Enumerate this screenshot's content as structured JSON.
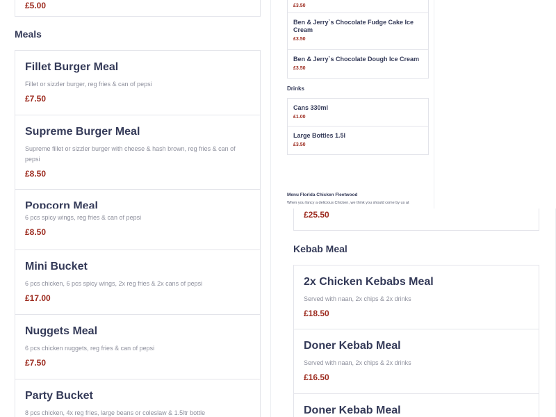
{
  "left_top": {
    "partial_price": "£5.00",
    "section_title": "Meals",
    "items": [
      {
        "name": "Fillet Burger Meal",
        "desc": "Fillet or sizzler burger, reg fries & can of pepsi",
        "price": "£7.50"
      },
      {
        "name": "Supreme Burger Meal",
        "desc": "Supreme fillet or sizzler burger with cheese & hash brown, reg fries & can of pepsi",
        "price": "£8.50"
      },
      {
        "name": "Popcorn Meal"
      }
    ]
  },
  "middle": {
    "items_top": [
      {
        "price": "£3.50"
      },
      {
        "name": "Ben & Jerry`s Chocolate Fudge Cake Ice Cream",
        "price": "£3.50"
      },
      {
        "name": "Ben & Jerry`s Chocolate Dough Ice Cream",
        "price": "£3.50"
      }
    ],
    "drinks_title": "Drinks",
    "drinks": [
      {
        "name": "Cans 330ml",
        "price": "£1.00"
      },
      {
        "name": "Large Bottles 1.5l",
        "price": "£3.50"
      }
    ],
    "footer_title": "Menu Florida Chicken Fleetwood",
    "footer_text": "When you fancy a delicious Chicken, we think you should come by us at"
  },
  "left_bottom": {
    "items": [
      {
        "desc": "6 pcs spicy wings, reg fries & can of pepsi",
        "price": "£8.50"
      },
      {
        "name": "Mini Bucket",
        "desc": "6 pcs chicken, 6 pcs spicy wings, 2x reg fries & 2x cans of pepsi",
        "price": "£17.00"
      },
      {
        "name": "Nuggets Meal",
        "desc": "6 pcs chicken nuggets, reg fries & can of pepsi",
        "price": "£7.50"
      },
      {
        "name": "Party Bucket",
        "desc": "8 pcs chicken, 4x reg fries, large beans or coleslaw & 1.5ltr bottle"
      }
    ]
  },
  "right_bottom": {
    "partial_price": "£25.50",
    "section_title": "Kebab Meal",
    "items": [
      {
        "name": "2x Chicken Kebabs Meal",
        "desc": "Served with naan, 2x chips & 2x drinks",
        "price": "£18.50"
      },
      {
        "name": "Doner Kebab Meal",
        "desc": "Served with naan, 2x chips & 2x drinks",
        "price": "£16.50"
      },
      {
        "name": "Doner Kebab Meal"
      }
    ]
  }
}
